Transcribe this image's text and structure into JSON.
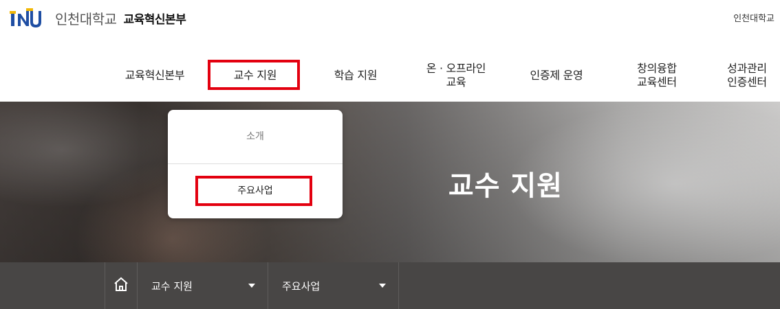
{
  "header": {
    "brand_name": "인천대학교",
    "department": "교육혁신본부",
    "top_link": "인천대학교",
    "logo_icon": "inu-logo-icon",
    "logo_colors": {
      "blue": "#1f4ea3",
      "yellow": "#f2b705"
    }
  },
  "nav": {
    "items": [
      {
        "label": "교육혁신본부"
      },
      {
        "label": "교수 지원"
      },
      {
        "label": "학습 지원"
      },
      {
        "label": "온 · 오프라인\n교육"
      },
      {
        "label": "인증제 운영"
      },
      {
        "label": "창의융합\n교육센터"
      },
      {
        "label": "성과관리\n인증센터"
      }
    ],
    "selected_index": 1,
    "highlight_color": "#e3000f"
  },
  "dropdown": {
    "items": [
      {
        "label": "소개"
      },
      {
        "label": "주요사업"
      }
    ],
    "highlighted_index": 1
  },
  "hero": {
    "title": "교수 지원"
  },
  "breadcrumb": {
    "home_icon": "home-icon",
    "items": [
      {
        "label": "교수 지원"
      },
      {
        "label": "주요사업"
      }
    ]
  }
}
